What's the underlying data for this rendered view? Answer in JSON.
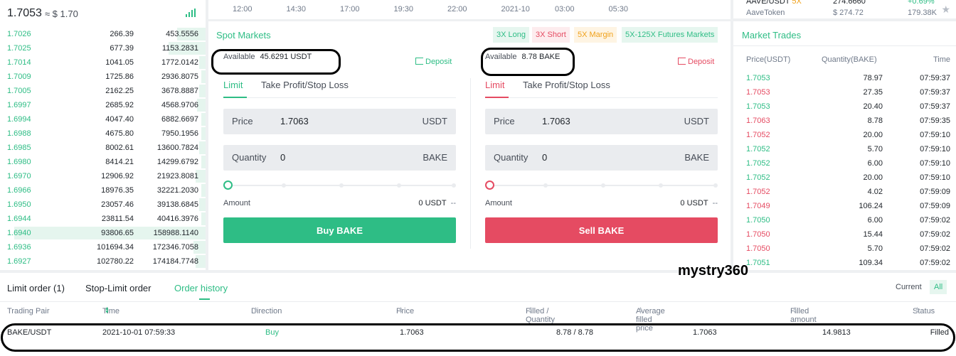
{
  "orderbook": {
    "last_price": "1.7053",
    "usd_equiv": "≈ $ 1.70",
    "rows": [
      {
        "price": "1.7026",
        "amount": "266.39",
        "total": "453.5556",
        "depth": 0.14
      },
      {
        "price": "1.7025",
        "amount": "677.39",
        "total": "1153.2831",
        "depth": 0.18
      },
      {
        "price": "1.7014",
        "amount": "1041.05",
        "total": "1772.0142",
        "depth": 0.03
      },
      {
        "price": "1.7009",
        "amount": "1725.86",
        "total": "2936.8075",
        "depth": 0.02
      },
      {
        "price": "1.7005",
        "amount": "2162.25",
        "total": "3678.8887",
        "depth": 0.03
      },
      {
        "price": "1.6997",
        "amount": "2685.92",
        "total": "4568.9706",
        "depth": 0.04
      },
      {
        "price": "1.6994",
        "amount": "4047.40",
        "total": "6882.6697",
        "depth": 0.02
      },
      {
        "price": "1.6988",
        "amount": "4675.80",
        "total": "7950.1956",
        "depth": 0.02
      },
      {
        "price": "1.6985",
        "amount": "8002.61",
        "total": "13600.7824",
        "depth": 0.03
      },
      {
        "price": "1.6980",
        "amount": "8414.21",
        "total": "14299.6792",
        "depth": 0.02
      },
      {
        "price": "1.6970",
        "amount": "12906.92",
        "total": "21923.8081",
        "depth": 0.05
      },
      {
        "price": "1.6966",
        "amount": "18976.35",
        "total": "32221.2030",
        "depth": 0.02
      },
      {
        "price": "1.6950",
        "amount": "23057.46",
        "total": "39138.6845",
        "depth": 0.03
      },
      {
        "price": "1.6944",
        "amount": "23811.54",
        "total": "40416.3976",
        "depth": 0.02
      },
      {
        "price": "1.6940",
        "amount": "93806.65",
        "total": "158988.1140",
        "depth": 0.93
      },
      {
        "price": "1.6936",
        "amount": "101694.34",
        "total": "172346.7058",
        "depth": 0.06
      },
      {
        "price": "1.6927",
        "amount": "102780.22",
        "total": "174184.7748",
        "depth": 0.05
      }
    ]
  },
  "chart": {
    "time_ticks": [
      "12:00",
      "14:30",
      "17:00",
      "19:30",
      "22:00",
      "2021-10",
      "03:00",
      "05:30"
    ]
  },
  "spot": {
    "title": "Spot Markets",
    "tags": [
      "3X Long",
      "3X Short",
      "5X Margin",
      "5X-125X Futures Markets"
    ],
    "buy": {
      "available_label": "Available",
      "available_value": "45.6291 USDT",
      "deposit": "Deposit",
      "tab_limit": "Limit",
      "tab_tpsl": "Take Profit/Stop Loss",
      "price_label": "Price",
      "price_value": "1.7063",
      "price_unit": "USDT",
      "qty_label": "Quantity",
      "qty_value": "0",
      "qty_unit": "BAKE",
      "amount_label": "Amount",
      "amount_value": "0 USDT",
      "amount_dash": "--",
      "button": "Buy BAKE"
    },
    "sell": {
      "available_label": "Available",
      "available_value": "8.78 BAKE",
      "deposit": "Deposit",
      "tab_limit": "Limit",
      "tab_tpsl": "Take Profit/Stop Loss",
      "price_label": "Price",
      "price_value": "1.7063",
      "price_unit": "USDT",
      "qty_label": "Quantity",
      "qty_value": "0",
      "qty_unit": "BAKE",
      "amount_label": "Amount",
      "amount_value": "0 USDT",
      "amount_dash": "--",
      "button": "Sell BAKE"
    }
  },
  "market_info": {
    "pair": "AAVE/USDT",
    "leverage": "5X",
    "price": "274.6660",
    "change": "+0.69%",
    "pair2": "AaveToken",
    "price2": "$ 274.72",
    "vol2": "179.38K"
  },
  "trades": {
    "title": "Market Trades",
    "headers": [
      "Price(USDT)",
      "Quantity(BAKE)",
      "Time"
    ],
    "rows": [
      {
        "price": "1.7053",
        "qty": "78.97",
        "time": "07:59:37",
        "side": "buy"
      },
      {
        "price": "1.7053",
        "qty": "27.35",
        "time": "07:59:37",
        "side": "sell"
      },
      {
        "price": "1.7053",
        "qty": "20.40",
        "time": "07:59:37",
        "side": "buy"
      },
      {
        "price": "1.7063",
        "qty": "8.78",
        "time": "07:59:35",
        "side": "sell"
      },
      {
        "price": "1.7052",
        "qty": "20.00",
        "time": "07:59:10",
        "side": "sell"
      },
      {
        "price": "1.7052",
        "qty": "5.70",
        "time": "07:59:10",
        "side": "buy"
      },
      {
        "price": "1.7052",
        "qty": "6.00",
        "time": "07:59:10",
        "side": "buy"
      },
      {
        "price": "1.7052",
        "qty": "20.00",
        "time": "07:59:10",
        "side": "buy"
      },
      {
        "price": "1.7052",
        "qty": "4.02",
        "time": "07:59:09",
        "side": "sell"
      },
      {
        "price": "1.7049",
        "qty": "106.24",
        "time": "07:59:09",
        "side": "sell"
      },
      {
        "price": "1.7050",
        "qty": "6.00",
        "time": "07:59:02",
        "side": "buy"
      },
      {
        "price": "1.7050",
        "qty": "15.44",
        "time": "07:59:02",
        "side": "sell"
      },
      {
        "price": "1.7050",
        "qty": "5.70",
        "time": "07:59:02",
        "side": "sell"
      },
      {
        "price": "1.7051",
        "qty": "109.34",
        "time": "07:59:02",
        "side": "buy"
      }
    ]
  },
  "orders": {
    "tabs": [
      "Limit order (1)",
      "Stop-Limit order",
      "Order history"
    ],
    "filter_current": "Current",
    "filter_all": "All",
    "headers": [
      "Trading Pair",
      "Time",
      "Direction",
      "Price",
      "Filled / Quantity",
      "Average filled price",
      "Filled amount",
      "Status"
    ],
    "row": {
      "pair": "BAKE/USDT",
      "time": "2021-10-01 07:59:33",
      "direction": "Buy",
      "price": "1.7063",
      "filled_qty": "8.78 / 8.78",
      "avg_price": "1.7063",
      "filled_amount": "14.9813",
      "status": "Filled"
    }
  },
  "watermark": "mystry360",
  "colors": {
    "green": "#2ebd85",
    "red": "#e54b62",
    "orange": "#f0a11a",
    "green_bg": "#e6f6ef",
    "red_bg": "#fdecee",
    "orange_bg": "#fef4e3"
  }
}
